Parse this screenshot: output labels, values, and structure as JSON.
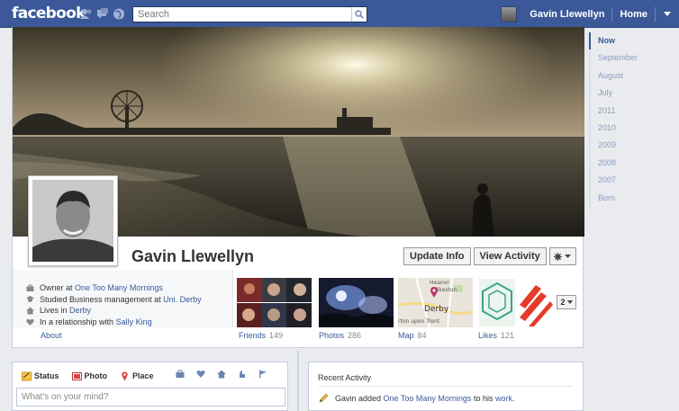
{
  "topbar": {
    "logo": "facebook",
    "search_placeholder": "Search",
    "user_name": "Gavin Llewellyn",
    "home_label": "Home",
    "color": "#3b5998"
  },
  "timeline_nav": [
    "Now",
    "September",
    "August",
    "July",
    "2011",
    "2010",
    "2009",
    "2008",
    "2007",
    "Born"
  ],
  "profile": {
    "name": "Gavin Llewellyn",
    "buttons": {
      "update_info": "Update Info",
      "view_activity": "View Activity"
    },
    "info": {
      "work_prefix": "Owner at",
      "work_link": "One Too Many Mornings",
      "study_prefix": "Studied Business management at",
      "study_link": "Uni. Derby",
      "lives_prefix": "Lives in",
      "lives_link": "Derby",
      "rel_prefix": "In a relationship with",
      "rel_link": "Sally King"
    },
    "about_label": "About",
    "apps": [
      {
        "label": "Friends",
        "count": "149"
      },
      {
        "label": "Photos",
        "count": "286"
      },
      {
        "label": "Map",
        "count": "84"
      },
      {
        "label": "Likes",
        "count": "121"
      }
    ],
    "map_places": {
      "p1": "Heanor",
      "p2": "Ilkeston",
      "p3": "Derby",
      "p4": "rton upon Trent"
    },
    "more_count": "2"
  },
  "composer": {
    "tabs": [
      "Status",
      "Photo",
      "Place"
    ],
    "placeholder": "What's on your mind?"
  },
  "recent": {
    "title": "Recent Activity",
    "item_prefix": "Gavin added ",
    "item_link1": "One Too Many Mornings",
    "item_mid": " to his ",
    "item_link2": "work",
    "item_suffix": "."
  }
}
